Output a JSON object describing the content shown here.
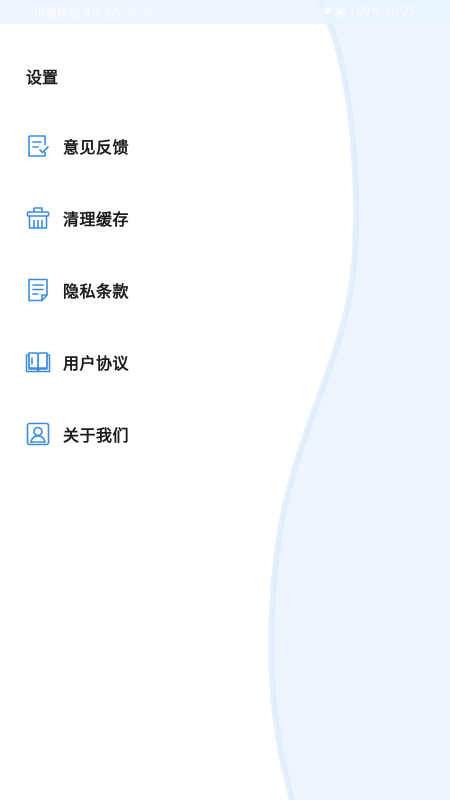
{
  "status_bar": {
    "left_text": "中国移动 4G 5G ⓝ ⓤ",
    "right_text": "✱ ▣ 100% 10:25"
  },
  "page": {
    "title": "设置"
  },
  "menu": {
    "items": [
      {
        "label": "意见反馈",
        "icon": "feedback-icon"
      },
      {
        "label": "清理缓存",
        "icon": "clear-cache-icon"
      },
      {
        "label": "隐私条款",
        "icon": "privacy-icon"
      },
      {
        "label": "用户协议",
        "icon": "agreement-icon"
      },
      {
        "label": "关于我们",
        "icon": "about-icon"
      }
    ]
  },
  "colors": {
    "accent": "#3d8be0",
    "background_light": "#edf5ff",
    "text": "#1c1c1c"
  }
}
